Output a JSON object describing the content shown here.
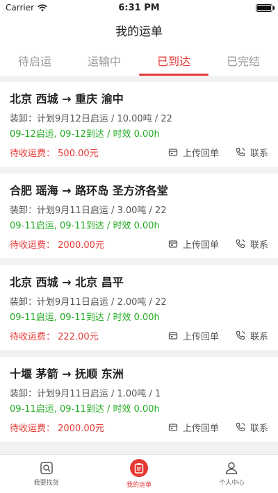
{
  "status_bar": {
    "carrier": "Carrier",
    "time": "6:31 PM"
  },
  "nav": {
    "title": "我的运单"
  },
  "tabs": [
    {
      "label": "待启运",
      "active": false
    },
    {
      "label": "运输中",
      "active": false
    },
    {
      "label": "已到达",
      "active": true
    },
    {
      "label": "已完结",
      "active": false
    }
  ],
  "colors": {
    "accent": "#e53935",
    "timing": "#22aa22"
  },
  "actions": {
    "upload": "上传回单",
    "contact": "联系"
  },
  "orders": [
    {
      "route": "北京 西城 → 重庆 渝中",
      "info": "装卸：计划9月12日启运 / 10.00吨 / 22",
      "timing": "09-12启运, 09-12到达 / 时效 0.00h",
      "fee_label": "待收运费：",
      "fee_value": "500.00元"
    },
    {
      "route": "合肥 瑶海 → 路环岛 圣方济各堂",
      "info": "装卸：计划9月11日启运 / 3.00吨 / 22",
      "timing": "09-11启运, 09-11到达 / 时效 0.00h",
      "fee_label": "待收运费：",
      "fee_value": "2000.00元"
    },
    {
      "route": "北京 西城 → 北京 昌平",
      "info": "装卸：计划9月11日启运 / 2.00吨 / 22",
      "timing": "09-11启运, 09-11到达 / 时效 0.00h",
      "fee_label": "待收运费：",
      "fee_value": "222.00元"
    },
    {
      "route": "十堰 茅箭 → 抚顺 东洲",
      "info": "装卸：计划9月11日启运 / 1.00吨 / 1",
      "timing": "09-11启运, 09-11到达 / 时效 0.00h",
      "fee_label": "待收运费：",
      "fee_value": "2000.00元"
    }
  ],
  "tabbar": [
    {
      "label": "我要找货",
      "icon": "search-cargo-icon"
    },
    {
      "label": "我的运单",
      "icon": "clipboard-icon",
      "active": true
    },
    {
      "label": "个人中心",
      "icon": "user-icon"
    }
  ]
}
